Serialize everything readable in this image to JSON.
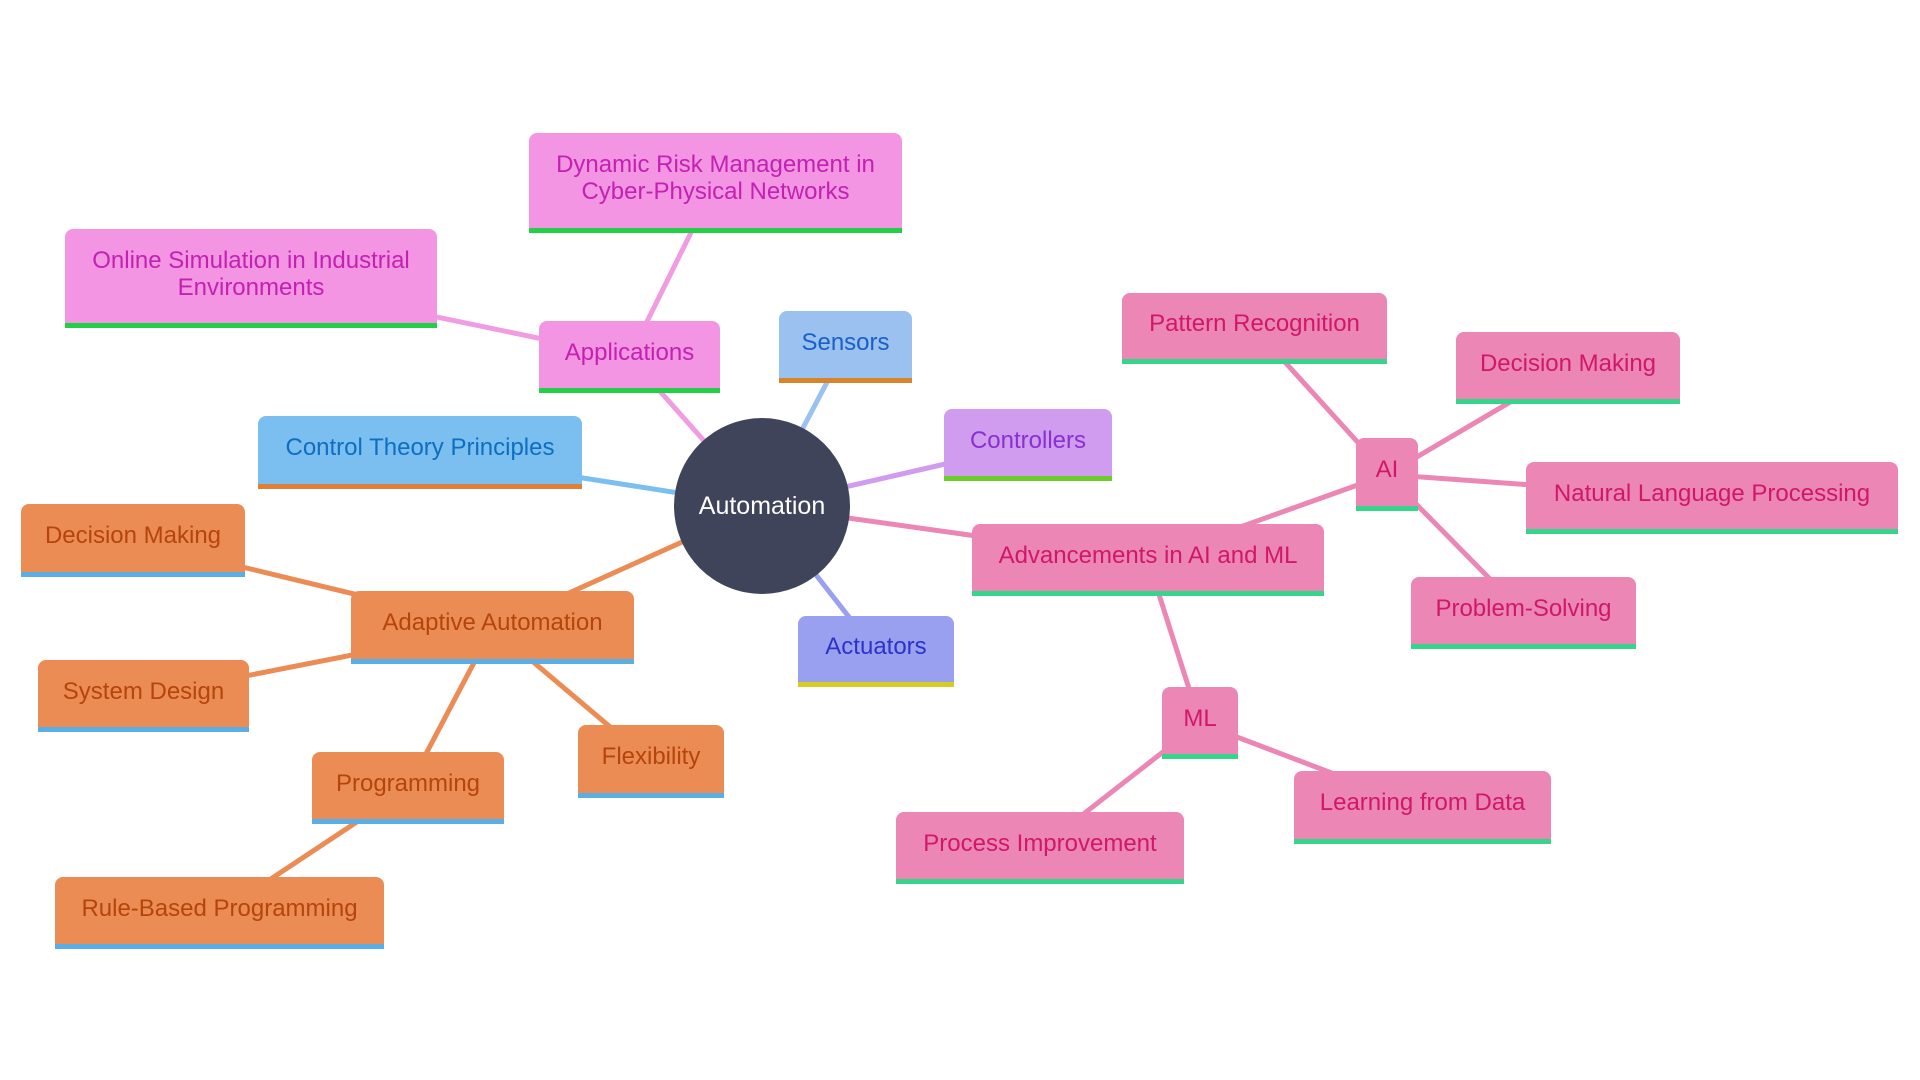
{
  "diagram": {
    "type": "mindmap",
    "root": {
      "id": "automation",
      "label": "Automation",
      "color": "#40445b",
      "text_color": "#ffffff"
    },
    "palettes": {
      "applications": {
        "fill": "#f395e3",
        "text": "#c321b1",
        "underline": "#22d045",
        "edge": "#f09ce3"
      },
      "sensors": {
        "fill": "#9ac1f0",
        "text": "#1b60c4",
        "underline": "#d88428",
        "edge": "#9ac1f0"
      },
      "control": {
        "fill": "#7bbff0",
        "text": "#0f6ec0",
        "underline": "#e07f36",
        "edge": "#7bbff0"
      },
      "controllers": {
        "fill": "#cf9cf0",
        "text": "#8a2fd0",
        "underline": "#6bcc2a",
        "edge": "#cf9cf0"
      },
      "adaptive": {
        "fill": "#ec8c55",
        "text": "#b4450c",
        "underline": "#5aaee6",
        "edge": "#ec8c55"
      },
      "actuators": {
        "fill": "#9aa0f0",
        "text": "#2c33c8",
        "underline": "#d8cc22",
        "edge": "#9aa0f0"
      },
      "advancements": {
        "fill": "#ec86b4",
        "text": "#d0186a",
        "underline": "#35d58c",
        "edge": "#ec86b4"
      }
    },
    "nodes": [
      {
        "id": "applications",
        "label": "Applications",
        "parent": "automation",
        "palette": "applications"
      },
      {
        "id": "dynamic-risk",
        "label": "Dynamic Risk Management in Cyber-Physical Networks",
        "parent": "applications",
        "palette": "applications"
      },
      {
        "id": "online-simulation",
        "label": "Online Simulation in Industrial Environments",
        "parent": "applications",
        "palette": "applications"
      },
      {
        "id": "sensors",
        "label": "Sensors",
        "parent": "automation",
        "palette": "sensors"
      },
      {
        "id": "control-theory",
        "label": "Control Theory Principles",
        "parent": "automation",
        "palette": "control"
      },
      {
        "id": "controllers",
        "label": "Controllers",
        "parent": "automation",
        "palette": "controllers"
      },
      {
        "id": "adaptive-automation",
        "label": "Adaptive Automation",
        "parent": "automation",
        "palette": "adaptive"
      },
      {
        "id": "decision-making-adaptive",
        "label": "Decision Making",
        "parent": "adaptive-automation",
        "palette": "adaptive"
      },
      {
        "id": "system-design",
        "label": "System Design",
        "parent": "adaptive-automation",
        "palette": "adaptive"
      },
      {
        "id": "flexibility",
        "label": "Flexibility",
        "parent": "adaptive-automation",
        "palette": "adaptive"
      },
      {
        "id": "programming",
        "label": "Programming",
        "parent": "adaptive-automation",
        "palette": "adaptive"
      },
      {
        "id": "rule-based-programming",
        "label": "Rule-Based Programming",
        "parent": "programming",
        "palette": "adaptive"
      },
      {
        "id": "actuators",
        "label": "Actuators",
        "parent": "automation",
        "palette": "actuators"
      },
      {
        "id": "advancements",
        "label": "Advancements in AI and ML",
        "parent": "automation",
        "palette": "advancements"
      },
      {
        "id": "ai",
        "label": "AI",
        "parent": "advancements",
        "palette": "advancements"
      },
      {
        "id": "pattern-recognition",
        "label": "Pattern Recognition",
        "parent": "ai",
        "palette": "advancements"
      },
      {
        "id": "decision-making-ai",
        "label": "Decision Making",
        "parent": "ai",
        "palette": "advancements"
      },
      {
        "id": "nlp",
        "label": "Natural Language Processing",
        "parent": "ai",
        "palette": "advancements"
      },
      {
        "id": "problem-solving",
        "label": "Problem-Solving",
        "parent": "ai",
        "palette": "advancements"
      },
      {
        "id": "ml",
        "label": "ML",
        "parent": "advancements",
        "palette": "advancements"
      },
      {
        "id": "learning-from-data",
        "label": "Learning from Data",
        "parent": "ml",
        "palette": "advancements"
      },
      {
        "id": "process-improvement",
        "label": "Process Improvement",
        "parent": "ml",
        "palette": "advancements"
      }
    ]
  }
}
